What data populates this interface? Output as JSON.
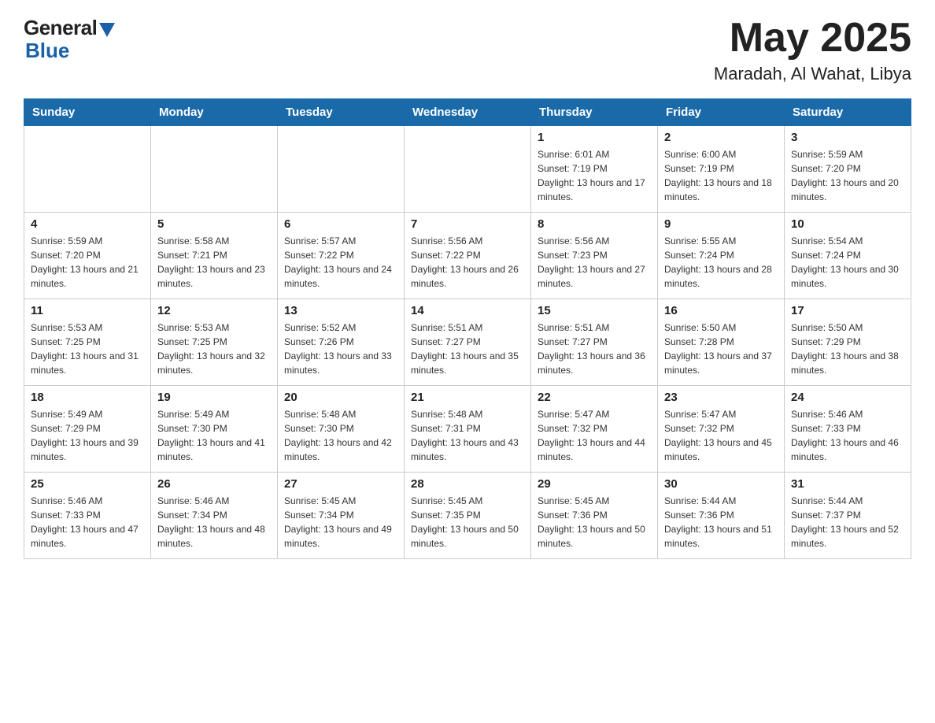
{
  "header": {
    "logo_general": "General",
    "logo_blue": "Blue",
    "month_year": "May 2025",
    "location": "Maradah, Al Wahat, Libya"
  },
  "days_of_week": [
    "Sunday",
    "Monday",
    "Tuesday",
    "Wednesday",
    "Thursday",
    "Friday",
    "Saturday"
  ],
  "weeks": [
    [
      {
        "day": "",
        "info": ""
      },
      {
        "day": "",
        "info": ""
      },
      {
        "day": "",
        "info": ""
      },
      {
        "day": "",
        "info": ""
      },
      {
        "day": "1",
        "info": "Sunrise: 6:01 AM\nSunset: 7:19 PM\nDaylight: 13 hours and 17 minutes."
      },
      {
        "day": "2",
        "info": "Sunrise: 6:00 AM\nSunset: 7:19 PM\nDaylight: 13 hours and 18 minutes."
      },
      {
        "day": "3",
        "info": "Sunrise: 5:59 AM\nSunset: 7:20 PM\nDaylight: 13 hours and 20 minutes."
      }
    ],
    [
      {
        "day": "4",
        "info": "Sunrise: 5:59 AM\nSunset: 7:20 PM\nDaylight: 13 hours and 21 minutes."
      },
      {
        "day": "5",
        "info": "Sunrise: 5:58 AM\nSunset: 7:21 PM\nDaylight: 13 hours and 23 minutes."
      },
      {
        "day": "6",
        "info": "Sunrise: 5:57 AM\nSunset: 7:22 PM\nDaylight: 13 hours and 24 minutes."
      },
      {
        "day": "7",
        "info": "Sunrise: 5:56 AM\nSunset: 7:22 PM\nDaylight: 13 hours and 26 minutes."
      },
      {
        "day": "8",
        "info": "Sunrise: 5:56 AM\nSunset: 7:23 PM\nDaylight: 13 hours and 27 minutes."
      },
      {
        "day": "9",
        "info": "Sunrise: 5:55 AM\nSunset: 7:24 PM\nDaylight: 13 hours and 28 minutes."
      },
      {
        "day": "10",
        "info": "Sunrise: 5:54 AM\nSunset: 7:24 PM\nDaylight: 13 hours and 30 minutes."
      }
    ],
    [
      {
        "day": "11",
        "info": "Sunrise: 5:53 AM\nSunset: 7:25 PM\nDaylight: 13 hours and 31 minutes."
      },
      {
        "day": "12",
        "info": "Sunrise: 5:53 AM\nSunset: 7:25 PM\nDaylight: 13 hours and 32 minutes."
      },
      {
        "day": "13",
        "info": "Sunrise: 5:52 AM\nSunset: 7:26 PM\nDaylight: 13 hours and 33 minutes."
      },
      {
        "day": "14",
        "info": "Sunrise: 5:51 AM\nSunset: 7:27 PM\nDaylight: 13 hours and 35 minutes."
      },
      {
        "day": "15",
        "info": "Sunrise: 5:51 AM\nSunset: 7:27 PM\nDaylight: 13 hours and 36 minutes."
      },
      {
        "day": "16",
        "info": "Sunrise: 5:50 AM\nSunset: 7:28 PM\nDaylight: 13 hours and 37 minutes."
      },
      {
        "day": "17",
        "info": "Sunrise: 5:50 AM\nSunset: 7:29 PM\nDaylight: 13 hours and 38 minutes."
      }
    ],
    [
      {
        "day": "18",
        "info": "Sunrise: 5:49 AM\nSunset: 7:29 PM\nDaylight: 13 hours and 39 minutes."
      },
      {
        "day": "19",
        "info": "Sunrise: 5:49 AM\nSunset: 7:30 PM\nDaylight: 13 hours and 41 minutes."
      },
      {
        "day": "20",
        "info": "Sunrise: 5:48 AM\nSunset: 7:30 PM\nDaylight: 13 hours and 42 minutes."
      },
      {
        "day": "21",
        "info": "Sunrise: 5:48 AM\nSunset: 7:31 PM\nDaylight: 13 hours and 43 minutes."
      },
      {
        "day": "22",
        "info": "Sunrise: 5:47 AM\nSunset: 7:32 PM\nDaylight: 13 hours and 44 minutes."
      },
      {
        "day": "23",
        "info": "Sunrise: 5:47 AM\nSunset: 7:32 PM\nDaylight: 13 hours and 45 minutes."
      },
      {
        "day": "24",
        "info": "Sunrise: 5:46 AM\nSunset: 7:33 PM\nDaylight: 13 hours and 46 minutes."
      }
    ],
    [
      {
        "day": "25",
        "info": "Sunrise: 5:46 AM\nSunset: 7:33 PM\nDaylight: 13 hours and 47 minutes."
      },
      {
        "day": "26",
        "info": "Sunrise: 5:46 AM\nSunset: 7:34 PM\nDaylight: 13 hours and 48 minutes."
      },
      {
        "day": "27",
        "info": "Sunrise: 5:45 AM\nSunset: 7:34 PM\nDaylight: 13 hours and 49 minutes."
      },
      {
        "day": "28",
        "info": "Sunrise: 5:45 AM\nSunset: 7:35 PM\nDaylight: 13 hours and 50 minutes."
      },
      {
        "day": "29",
        "info": "Sunrise: 5:45 AM\nSunset: 7:36 PM\nDaylight: 13 hours and 50 minutes."
      },
      {
        "day": "30",
        "info": "Sunrise: 5:44 AM\nSunset: 7:36 PM\nDaylight: 13 hours and 51 minutes."
      },
      {
        "day": "31",
        "info": "Sunrise: 5:44 AM\nSunset: 7:37 PM\nDaylight: 13 hours and 52 minutes."
      }
    ]
  ]
}
